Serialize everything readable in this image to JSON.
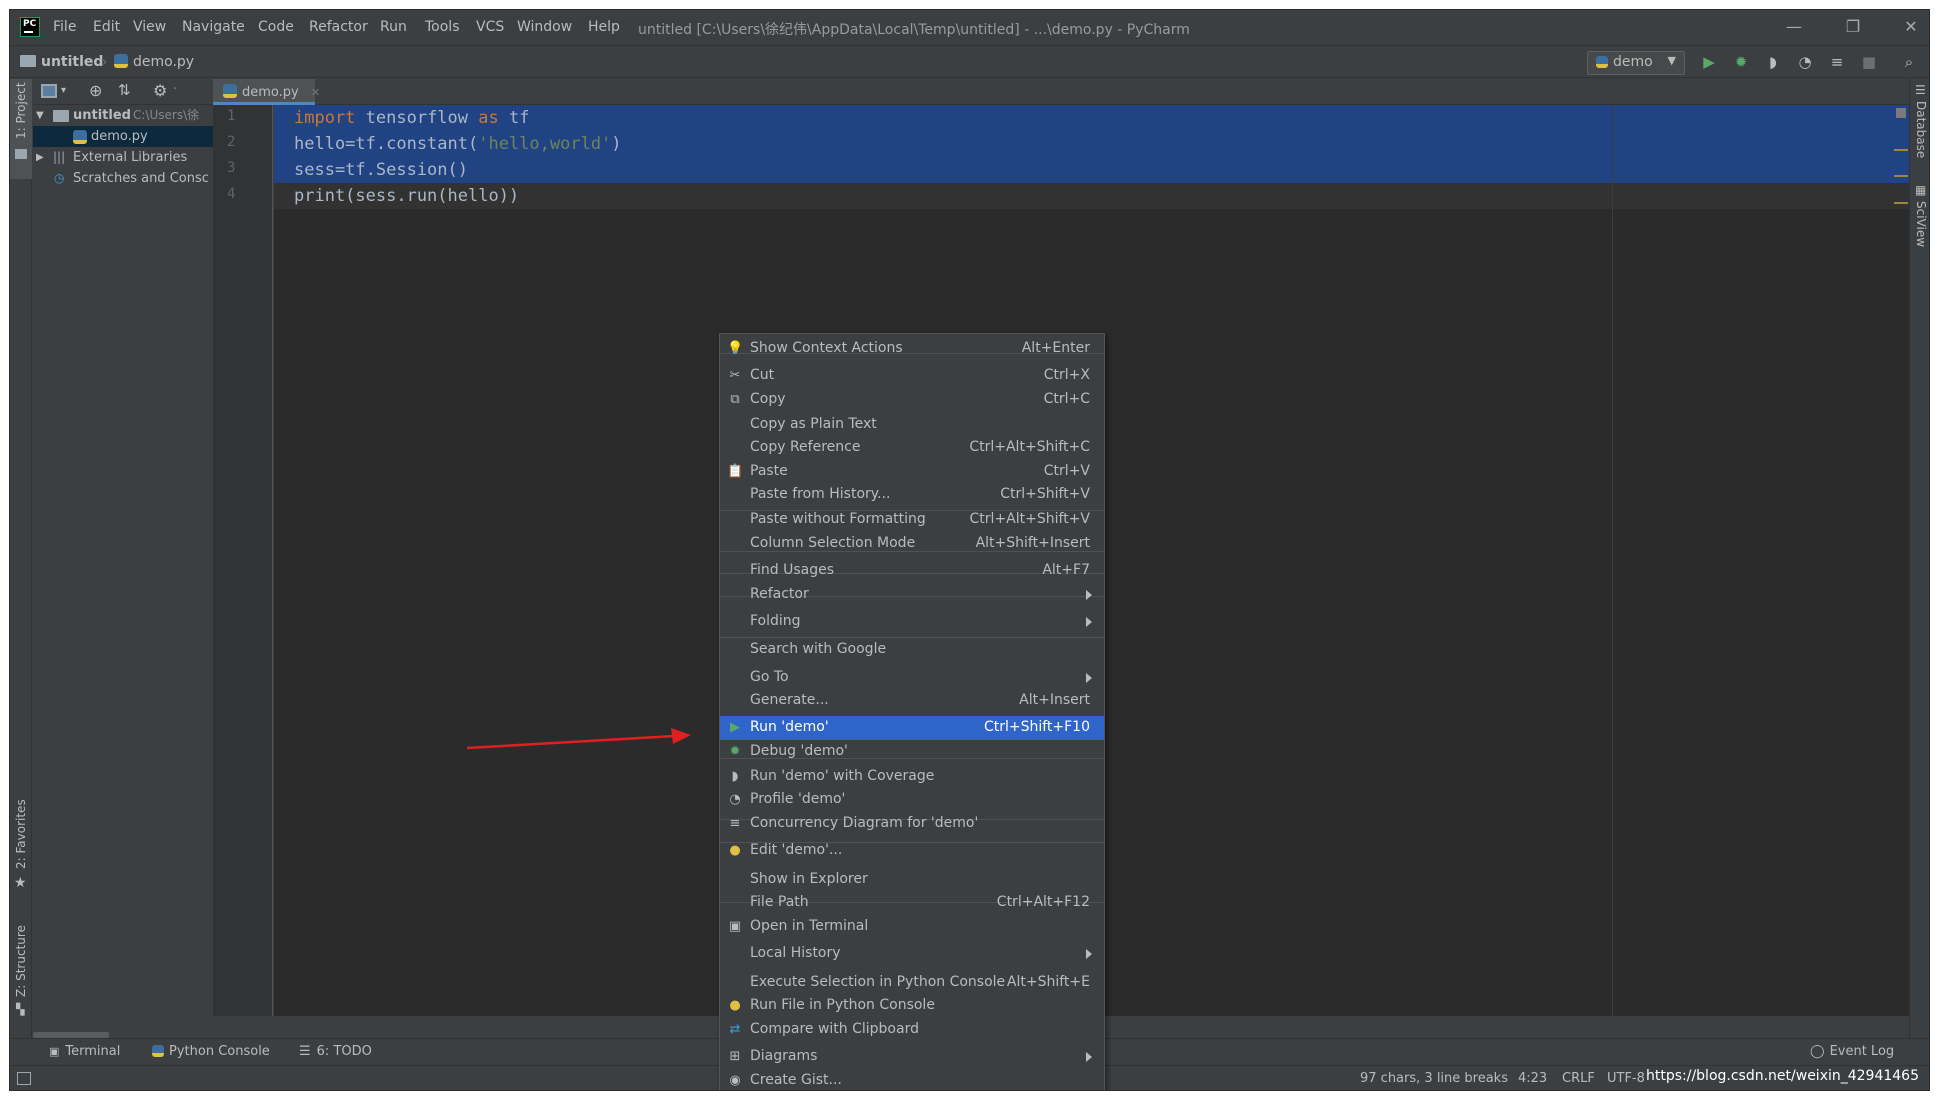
{
  "titlebar": {
    "menus": [
      "File",
      "Edit",
      "View",
      "Navigate",
      "Code",
      "Refactor",
      "Run",
      "Tools",
      "VCS",
      "Window",
      "Help"
    ],
    "window_title": "untitled [C:\\Users\\徐纪伟\\AppData\\Local\\Temp\\untitled] - ...\\demo.py - PyCharm",
    "minimize": "—",
    "restore": "❐",
    "close": "✕"
  },
  "navbar": {
    "project": "untitled",
    "file": "demo.py",
    "run_config": "demo"
  },
  "left_stripe": {
    "project": "1: Project",
    "favorites": "2: Favorites",
    "structure": "Z: Structure"
  },
  "right_stripe": {
    "database": "Database",
    "sciview": "SciView"
  },
  "project_tree": {
    "root": "untitled",
    "root_path": "C:\\Users\\徐",
    "file": "demo.py",
    "libs": "External Libraries",
    "scratches": "Scratches and Consc"
  },
  "editor": {
    "tab": "demo.py",
    "line_numbers": [
      "1",
      "2",
      "3",
      "4"
    ],
    "lines": [
      {
        "parts": [
          {
            "t": "import",
            "c": "kw"
          },
          {
            "t": " tensorflow ",
            "c": ""
          },
          {
            "t": "as",
            "c": "kw"
          },
          {
            "t": " tf",
            "c": ""
          }
        ]
      },
      {
        "parts": [
          {
            "t": "hello=tf.constant(",
            "c": ""
          },
          {
            "t": "'hello,world'",
            "c": "str"
          },
          {
            "t": ")",
            "c": ""
          }
        ]
      },
      {
        "parts": [
          {
            "t": "sess=tf.Session()",
            "c": ""
          }
        ]
      },
      {
        "parts": [
          {
            "t": "print(sess.run(hello))",
            "c": ""
          }
        ]
      }
    ]
  },
  "context_menu": {
    "items": [
      {
        "label": "Show Context Actions",
        "shortcut": "Alt+Enter",
        "icon": "lightbulb-icon"
      },
      {
        "label": "Cut",
        "shortcut": "Ctrl+X",
        "icon": "scissors-icon"
      },
      {
        "label": "Copy",
        "shortcut": "Ctrl+C",
        "icon": "copy-icon"
      },
      {
        "label": "Copy as Plain Text",
        "shortcut": ""
      },
      {
        "label": "Copy Reference",
        "shortcut": "Ctrl+Alt+Shift+C"
      },
      {
        "label": "Paste",
        "shortcut": "Ctrl+V",
        "icon": "clipboard-icon"
      },
      {
        "label": "Paste from History...",
        "shortcut": "Ctrl+Shift+V"
      },
      {
        "label": "Paste without Formatting",
        "shortcut": "Ctrl+Alt+Shift+V"
      },
      {
        "label": "Column Selection Mode",
        "shortcut": "Alt+Shift+Insert"
      },
      {
        "label": "Find Usages",
        "shortcut": "Alt+F7"
      },
      {
        "label": "Refactor",
        "shortcut": "",
        "submenu": true
      },
      {
        "label": "Folding",
        "shortcut": "",
        "submenu": true
      },
      {
        "label": "Search with Google",
        "shortcut": ""
      },
      {
        "label": "Go To",
        "shortcut": "",
        "submenu": true
      },
      {
        "label": "Generate...",
        "shortcut": "Alt+Insert"
      },
      {
        "label": "Run 'demo'",
        "shortcut": "Ctrl+Shift+F10",
        "icon": "run-icon",
        "highlight": true
      },
      {
        "label": "Debug 'demo'",
        "shortcut": "",
        "icon": "debug-icon"
      },
      {
        "label": "Run 'demo' with Coverage",
        "shortcut": "",
        "icon": "coverage-icon"
      },
      {
        "label": "Profile 'demo'",
        "shortcut": "",
        "icon": "profile-icon"
      },
      {
        "label": "Concurrency Diagram for 'demo'",
        "shortcut": "",
        "icon": "concurrency-icon"
      },
      {
        "label": "Edit 'demo'...",
        "shortcut": "",
        "icon": "python-icon"
      },
      {
        "label": "Show in Explorer",
        "shortcut": ""
      },
      {
        "label": "File Path",
        "shortcut": "Ctrl+Alt+F12"
      },
      {
        "label": "Open in Terminal",
        "shortcut": "",
        "icon": "terminal-icon"
      },
      {
        "label": "Local History",
        "shortcut": "",
        "submenu": true
      },
      {
        "label": "Execute Selection in Python Console",
        "shortcut": "Alt+Shift+E"
      },
      {
        "label": "Run File in Python Console",
        "shortcut": "",
        "icon": "python-icon"
      },
      {
        "label": "Compare with Clipboard",
        "shortcut": "",
        "icon": "compare-icon"
      },
      {
        "label": "Diagrams",
        "shortcut": "",
        "icon": "diagram-icon",
        "submenu": true
      },
      {
        "label": "Create Gist...",
        "shortcut": "",
        "icon": "github-icon"
      }
    ]
  },
  "bottom_tabs": {
    "terminal": "Terminal",
    "python_console": "Python Console",
    "todo": "6: TODO",
    "event_log": "Event Log"
  },
  "status_bar": {
    "chars": "97 chars, 3 line breaks",
    "position": "4:23",
    "line_sep": "CRLF",
    "encoding": "UTF-8"
  },
  "watermark": "https://blog.csdn.net/weixin_42941465",
  "colors": {
    "accent": "#2f65ca",
    "selection": "#214283",
    "keyword": "#cc7832",
    "string": "#6a8759",
    "arrow": "#e02020"
  }
}
